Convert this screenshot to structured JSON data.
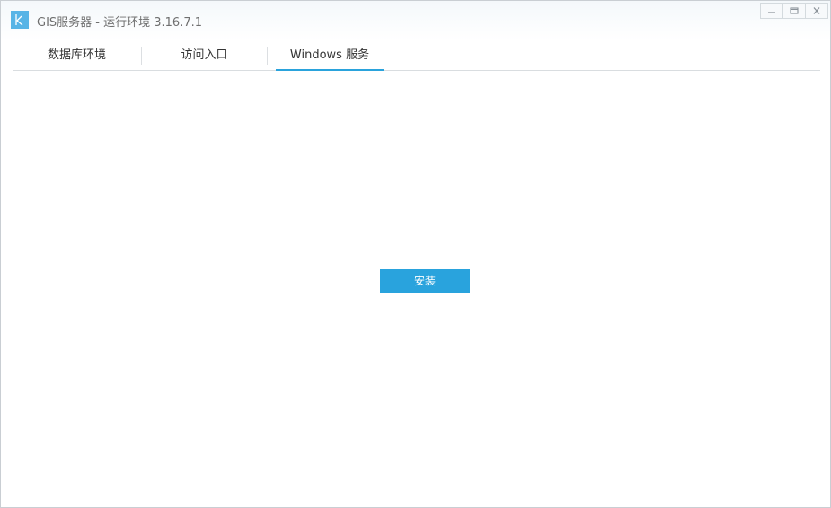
{
  "window": {
    "title": "GIS服务器 - 运行环境 3.16.7.1",
    "logo_icon": "k-logo-icon",
    "controls": [
      "minimize-icon",
      "maximize-icon",
      "close-icon"
    ]
  },
  "tabs": [
    {
      "label": "数据库环境",
      "active": false
    },
    {
      "label": "访问入口",
      "active": false
    },
    {
      "label": "Windows 服务",
      "active": true
    }
  ],
  "main": {
    "install_label": "安装"
  },
  "colors": {
    "accent": "#29a3dd",
    "logo": "#58b4e6"
  }
}
